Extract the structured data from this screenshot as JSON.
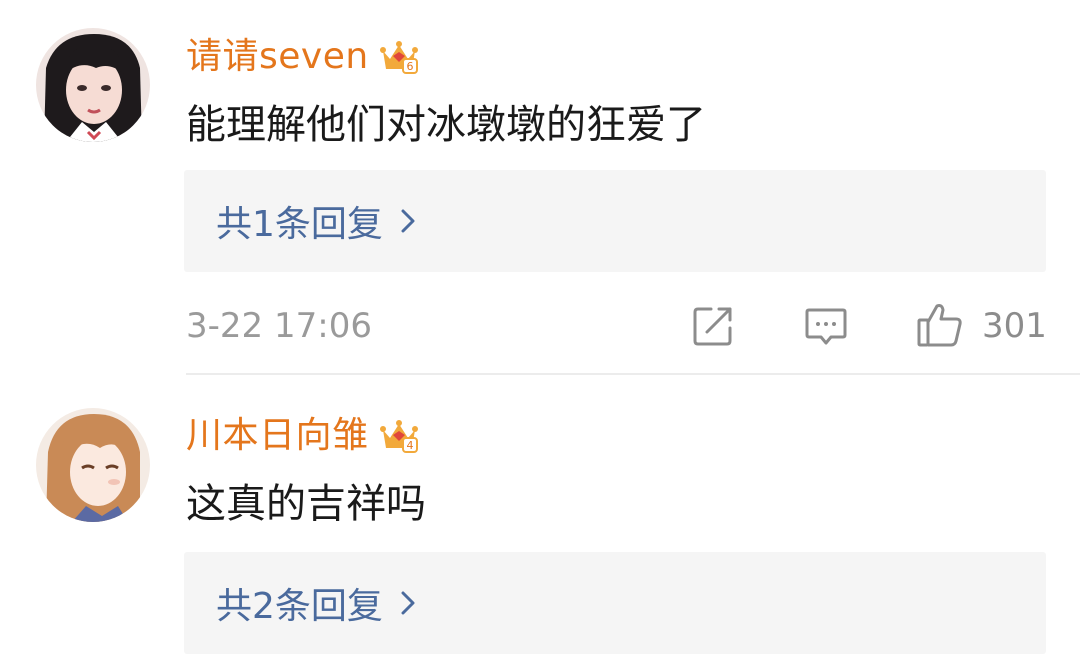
{
  "comments": [
    {
      "username": "请请seven",
      "avatar_icon": "avatar-portrait-dark-hair",
      "badge_icon": "vip-crown-badge",
      "badge_level": "6",
      "text": "能理解他们对冰墩墩的狂爱了",
      "reply_label": "共1条回复",
      "timestamp": "3-22 17:06",
      "likes": "301"
    },
    {
      "username": "川本日向雏",
      "avatar_icon": "avatar-portrait-light-hair",
      "badge_icon": "vip-crown-badge",
      "badge_level": "4",
      "text": "这真的吉祥吗",
      "reply_label": "共2条回复"
    }
  ],
  "colors": {
    "username": "#e4761c",
    "reply_link": "#4a6a9d",
    "reply_bg": "#f5f5f5",
    "meta_gray": "#9a9a9a",
    "crown_gold": "#f2a93b"
  }
}
